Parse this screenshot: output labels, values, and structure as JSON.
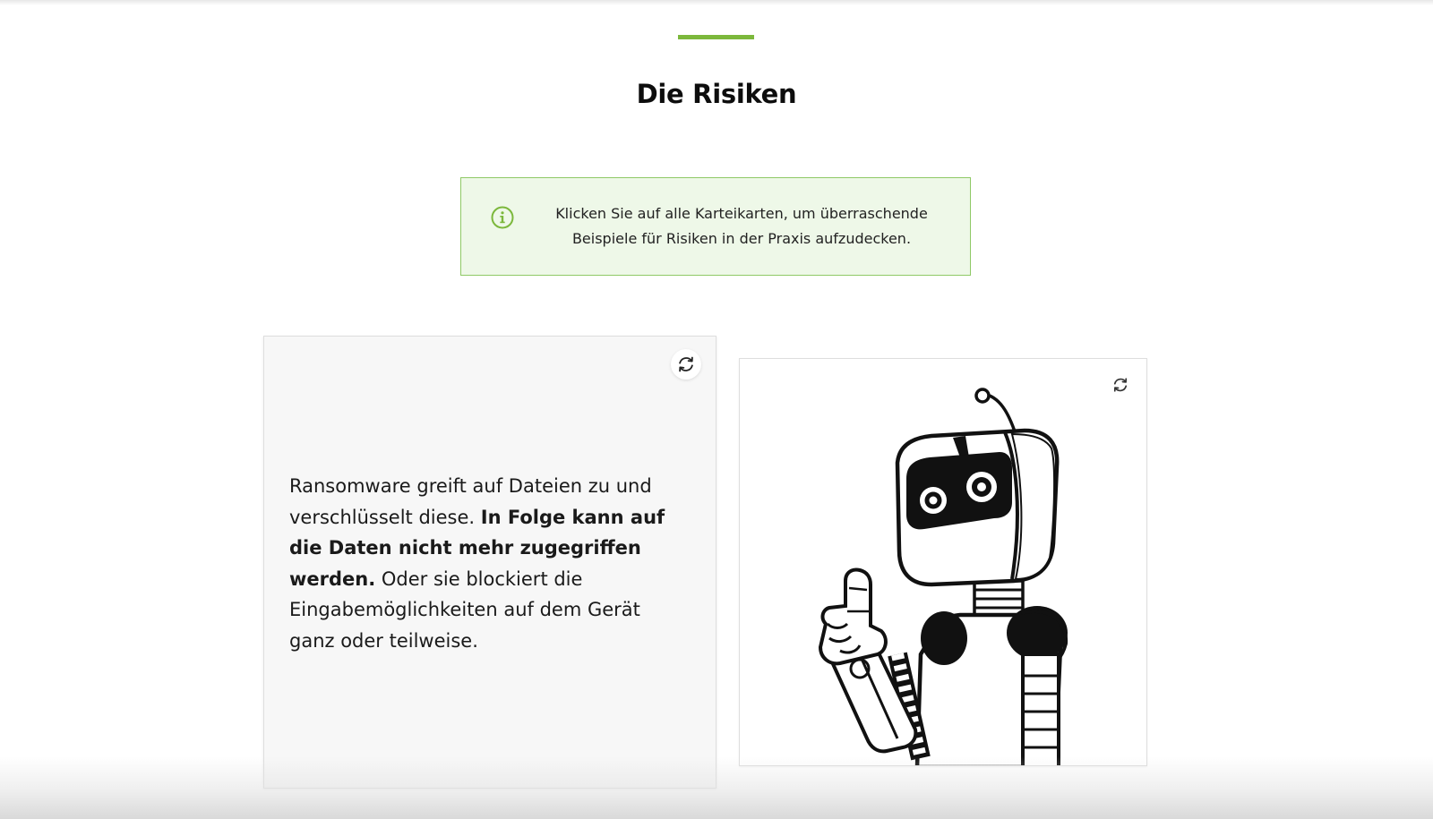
{
  "section": {
    "title": "Die Risiken"
  },
  "colors": {
    "accent": "#7cb83c",
    "info_background": "#eef8e8",
    "info_border": "#8fc966"
  },
  "info": {
    "icon": "info-circle-icon",
    "line1": "Klicken Sie auf alle Karteikarten, um überraschende",
    "line2": "Beispiele für Risiken in der Praxis aufzudecken."
  },
  "cards": [
    {
      "flip_icon": "refresh-icon",
      "parts": {
        "p1": "Ransomware greift auf Dateien zu und verschlüsselt diese. ",
        "p2_bold": "In Folge kann auf die Daten nicht mehr zugegriffen werden.",
        "p3": " Oder sie blockiert die Eingabemöglichkeiten auf dem Gerät ganz oder teilweise."
      }
    },
    {
      "flip_icon": "refresh-icon",
      "image": "robot-pointing-illustration"
    }
  ]
}
